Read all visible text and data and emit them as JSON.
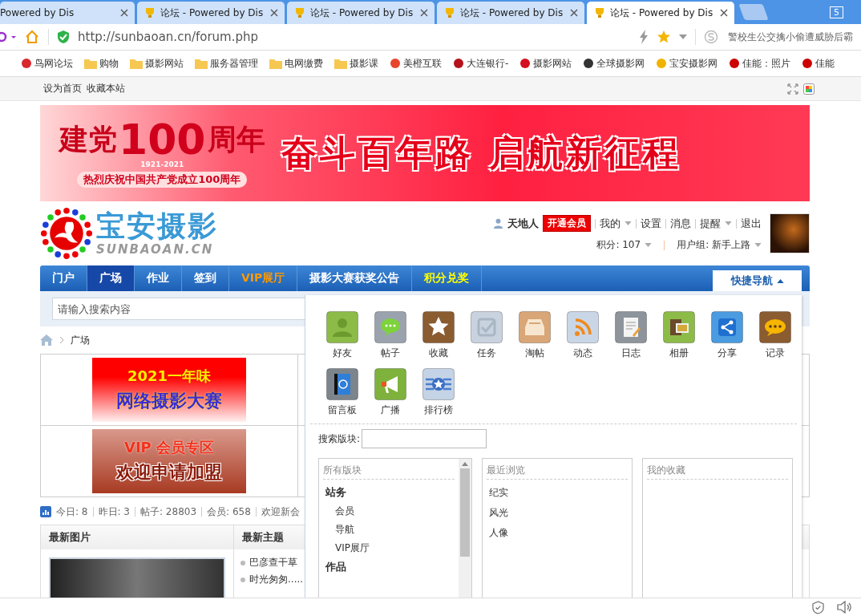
{
  "browser": {
    "tabs": [
      {
        "title": "Powered by Dis",
        "selected": false
      },
      {
        "title": "论坛 - Powered by Dis",
        "selected": false
      },
      {
        "title": "论坛 - Powered by Dis",
        "selected": false
      },
      {
        "title": "论坛 - Powered by Dis",
        "selected": false
      },
      {
        "title": "论坛 - Powered by Dis",
        "selected": true
      }
    ],
    "tab_count": "5",
    "url": "http://sunbaoan.cn/forum.php",
    "search": {
      "placeholder": "警校生公交擒小偷遭威胁后霸"
    },
    "bookmarks": [
      {
        "label": "鸟网论坛",
        "kind": "site",
        "color": "#d9272e"
      },
      {
        "label": "购物",
        "kind": "folder"
      },
      {
        "label": "摄影网站",
        "kind": "folder"
      },
      {
        "label": "服务器管理",
        "kind": "folder"
      },
      {
        "label": "电网缴费",
        "kind": "folder"
      },
      {
        "label": "摄影课",
        "kind": "folder"
      },
      {
        "label": "美橙互联",
        "kind": "site",
        "color": "#e8452c"
      },
      {
        "label": "大连银行-",
        "kind": "site",
        "color": "#b5121b"
      },
      {
        "label": "摄影网站",
        "kind": "site",
        "color": "#d40f1f"
      },
      {
        "label": "全球摄影网",
        "kind": "site",
        "color": "#333333"
      },
      {
        "label": "宝安摄影网",
        "kind": "site",
        "color": "#f0b400"
      },
      {
        "label": "佳能：照片",
        "kind": "site",
        "color": "#cc0000"
      },
      {
        "label": "佳能",
        "kind": "site",
        "color": "#cc0000"
      }
    ]
  },
  "page": {
    "top_links": [
      "设为首页",
      "收藏本站"
    ],
    "banner": {
      "title_left": "建党",
      "number": "100",
      "title_right": "周年",
      "years": "1921-2021",
      "subtitle": "热烈庆祝中国共产党成立100周年",
      "slogan": "奋斗百年路 启航新征程"
    },
    "logo": {
      "name": "宝安摄影",
      "domain": "SUNBAOAN.CN"
    },
    "user": {
      "name": "天地人",
      "vip_button": "开通会员",
      "links": [
        {
          "label": "我的",
          "dropdown": true
        },
        {
          "label": "设置",
          "dropdown": false
        },
        {
          "label": "消息",
          "dropdown": false
        },
        {
          "label": "提醒",
          "dropdown": true
        },
        {
          "label": "退出",
          "dropdown": false
        }
      ],
      "points": "积分: 107",
      "group": "用户组: 新手上路"
    },
    "nav": [
      {
        "label": "门户",
        "selected": false,
        "kind": "normal"
      },
      {
        "label": "广场",
        "selected": true,
        "kind": "normal"
      },
      {
        "label": "作业",
        "selected": false,
        "kind": "normal"
      },
      {
        "label": "签到",
        "selected": false,
        "kind": "normal"
      },
      {
        "label": "VIP展厅",
        "selected": false,
        "kind": "vip"
      },
      {
        "label": "摄影大赛获奖公告",
        "selected": false,
        "kind": "normal"
      },
      {
        "label": "积分兑奖",
        "selected": false,
        "kind": "points"
      }
    ],
    "quick_nav": {
      "label": "快捷导航",
      "expanded": true,
      "items": [
        "好友",
        "帖子",
        "收藏",
        "任务",
        "淘帖",
        "动态",
        "日志",
        "相册",
        "分享",
        "记录",
        "留言板",
        "广播",
        "排行榜"
      ],
      "forum_search_label": "搜索版块:",
      "all_forums": {
        "title": "所有版块",
        "forums": [
          {
            "label": "站务",
            "children": [
              {
                "label": "会员"
              },
              {
                "label": "导航"
              },
              {
                "label": "VIP展厅"
              }
            ]
          },
          {
            "label": "作品"
          }
        ]
      },
      "recent": {
        "title": "最近浏览",
        "items": [
          "纪实",
          "风光",
          "人像"
        ]
      },
      "favorites": {
        "title": "我的收藏"
      }
    },
    "search": {
      "placeholder": "请输入搜索内容"
    },
    "breadcrumb": [
      "广场"
    ],
    "ads": [
      {
        "line1": "2021一年味",
        "line2": "网络摄影大赛"
      },
      {
        "line1": "VIP 会员专区",
        "line2": "欢迎申请加盟"
      }
    ],
    "stats": [
      "今日: 8",
      "昨日: 3",
      "帖子: 28803",
      "会员: 658",
      "欢迎新会"
    ],
    "latest_photos": {
      "title": "最新图片"
    },
    "latest_threads": {
      "title": "最新主题",
      "items": [
        "巴彦查干草",
        "时光匆匆....."
      ]
    }
  }
}
